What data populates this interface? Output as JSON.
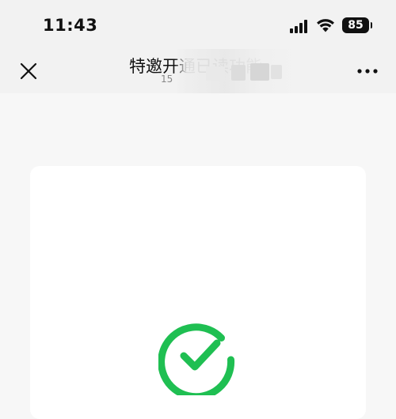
{
  "status_bar": {
    "time": "11:43",
    "battery": "85",
    "icons": [
      "cellular-signal-icon",
      "wifi-icon",
      "battery-icon"
    ]
  },
  "header": {
    "title": "特邀开通已读功能",
    "subtitle": "15",
    "close_icon": "close-icon",
    "more_icon": "more-icon"
  },
  "main": {
    "status_icon": "check-circle-icon",
    "accent_color": "#1fbf52"
  }
}
